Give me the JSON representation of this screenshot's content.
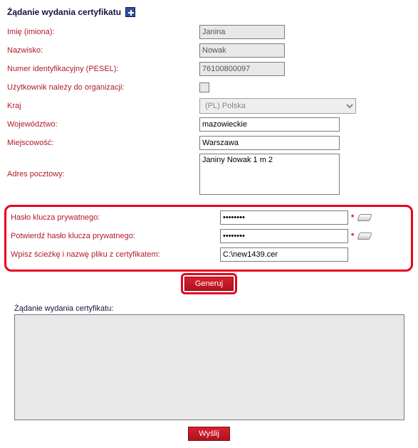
{
  "header": {
    "title": "Żądanie wydania certyfikatu"
  },
  "labels": {
    "firstname": "Imię (imiona):",
    "lastname": "Nazwisko:",
    "pesel": "Numer identyfikacyjny (PESEL):",
    "org": "Użytkownik należy do organizacji:",
    "country": "Kraj",
    "voivodeship": "Województwo:",
    "city": "Miejscowość:",
    "address": "Adres pocztowy:",
    "pk_pass": "Hasło klucza prywatnego:",
    "pk_pass_confirm": "Potwierdź hasło klucza prywatnego:",
    "cert_path": "Wpisz ścieżkę i nazwę pliku z certyfikatem:",
    "req_output": "Żądanie wydania certyfikatu:"
  },
  "values": {
    "firstname": "Janina",
    "lastname": "Nowak",
    "pesel": "76100800097",
    "country": "(PL) Polska",
    "voivodeship": "mazowieckie",
    "city": "Warszawa",
    "address": "Janiny Nowak 1 m 2",
    "pk_pass": "••••••••",
    "pk_pass_confirm": "••••••••",
    "cert_path": "C:\\new1439.cer",
    "req_output": ""
  },
  "buttons": {
    "generate": "Generuj",
    "send": "Wyślij"
  },
  "asterisk": "*"
}
